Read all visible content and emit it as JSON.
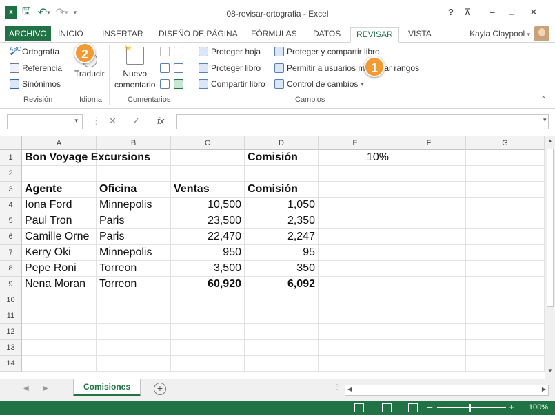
{
  "window": {
    "title": "08-revisar-ortografia - Excel",
    "help": "?",
    "minimize": "–",
    "maximize": "□",
    "close": "✕",
    "ribbon_display": "⊼"
  },
  "quick_access": {
    "save": "🖫",
    "undo": "↶",
    "redo": "↷",
    "customize": "▾"
  },
  "tabs": [
    {
      "label": "ARCHIVO"
    },
    {
      "label": "INICIO"
    },
    {
      "label": "INSERTAR"
    },
    {
      "label": "DISEÑO DE PÁGINA"
    },
    {
      "label": "FÓRMULAS"
    },
    {
      "label": "DATOS"
    },
    {
      "label": "REVISAR"
    },
    {
      "label": "VISTA"
    }
  ],
  "user": {
    "name": "Kayla Claypool",
    "dropdown": "▾"
  },
  "ribbon": {
    "revision": {
      "ortografia": "Ortografía",
      "referencia": "Referencia",
      "sinonimos": "Sinónimos",
      "group": "Revisión"
    },
    "idioma": {
      "traducir": "Traducir",
      "group": "Idioma"
    },
    "comentarios": {
      "nuevo_line1": "Nuevo",
      "nuevo_line2": "comentario",
      "group": "Comentarios"
    },
    "cambios": {
      "proteger_hoja": "Proteger hoja",
      "proteger_libro": "Proteger libro",
      "compartir_libro": "Compartir libro",
      "proteger_compartir": "Proteger y compartir libro",
      "permitir": "Permitir a usuarios modificar rangos",
      "control": "Control de cambios",
      "control_dd": "▾",
      "group": "Cambios"
    },
    "collapse": "⌃"
  },
  "callouts": [
    "1",
    "2"
  ],
  "formula_bar": {
    "namebox_dd": "▾",
    "cancel": "✕",
    "enter": "✓",
    "fx": "fx",
    "value": ""
  },
  "columns": [
    "A",
    "B",
    "C",
    "D",
    "E",
    "F",
    "G"
  ],
  "rows": [
    {
      "n": "1",
      "A": "Bon Voyage Excursions",
      "B": "",
      "C": "",
      "D": "Comisión",
      "E": "10%"
    },
    {
      "n": "2",
      "A": "",
      "B": "",
      "C": "",
      "D": "",
      "E": ""
    },
    {
      "n": "3",
      "A": "Agente",
      "B": "Oficina",
      "C": "Ventas",
      "D": "Comisión",
      "E": ""
    },
    {
      "n": "4",
      "A": "Iona Ford",
      "B": "Minnepolis",
      "C": "10,500",
      "D": "1,050",
      "E": ""
    },
    {
      "n": "5",
      "A": "Paul Tron",
      "B": "Paris",
      "C": "23,500",
      "D": "2,350",
      "E": ""
    },
    {
      "n": "6",
      "A": "Camille  Orne",
      "B": "Paris",
      "C": "22,470",
      "D": "2,247",
      "E": ""
    },
    {
      "n": "7",
      "A": "Kerry Oki",
      "B": "Minnepolis",
      "C": "950",
      "D": "95",
      "E": ""
    },
    {
      "n": "8",
      "A": "Pepe Roni",
      "B": "Torreon",
      "C": "3,500",
      "D": "350",
      "E": ""
    },
    {
      "n": "9",
      "A": "Nena Moran",
      "B": "Torreon",
      "C": "60,920",
      "D": "6,092",
      "E": ""
    },
    {
      "n": "10"
    },
    {
      "n": "11"
    },
    {
      "n": "12"
    },
    {
      "n": "13"
    },
    {
      "n": "14"
    }
  ],
  "sheets": {
    "active": "Comisiones",
    "add": "+",
    "prev": "◀",
    "next": "▶"
  },
  "status": {
    "zoom": "100%",
    "zoom_minus": "–",
    "zoom_plus": "+"
  },
  "colors": {
    "accent": "#217346",
    "callout": "#f39a32"
  }
}
